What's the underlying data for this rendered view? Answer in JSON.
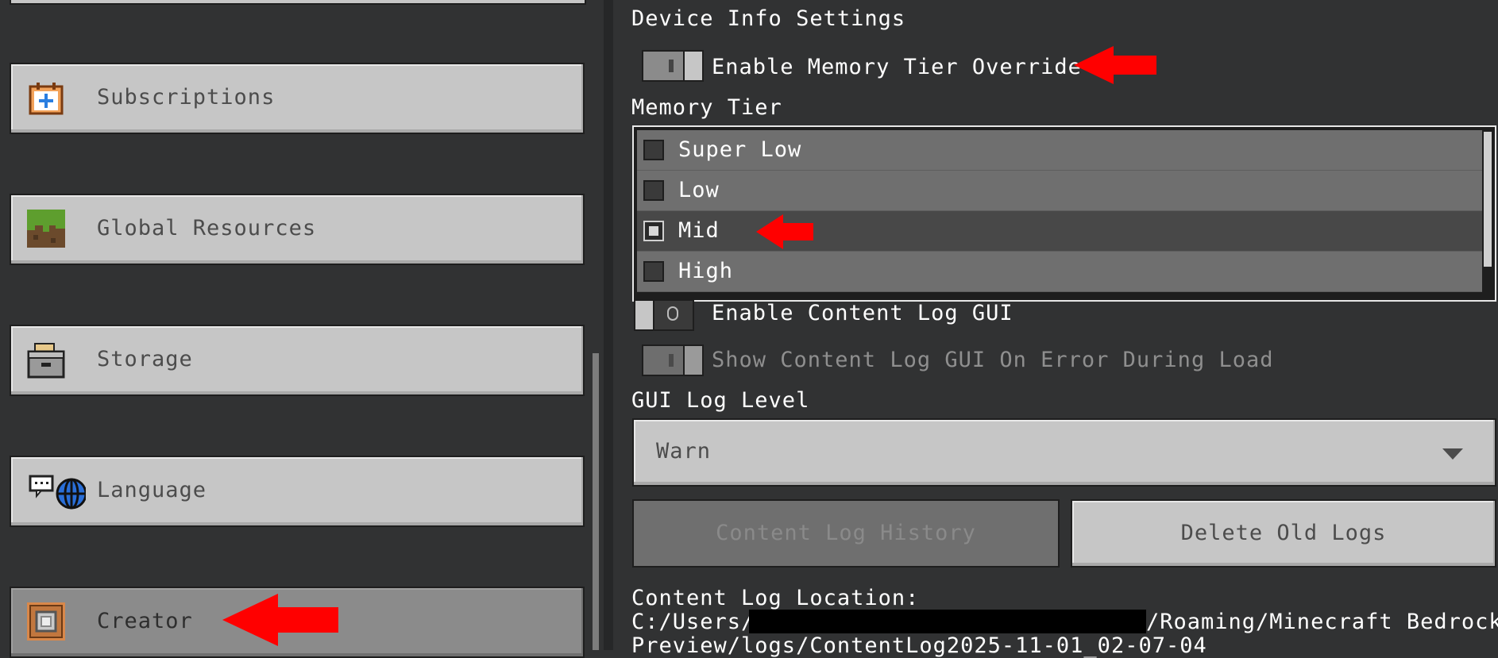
{
  "sidebar": {
    "items": [
      {
        "label": "Subscriptions",
        "icon": "subscriptions-icon"
      },
      {
        "label": "Global Resources",
        "icon": "grass-block-icon"
      },
      {
        "label": "Storage",
        "icon": "storage-box-icon"
      },
      {
        "label": "Language",
        "icon": "language-globe-icon"
      },
      {
        "label": "Creator",
        "icon": "command-block-icon",
        "selected": true
      }
    ]
  },
  "device_info": {
    "heading": "Device Info Settings",
    "memory_override_label": "Enable Memory Tier Override",
    "memory_override_on": true,
    "memory_tier_label": "Memory Tier",
    "memory_tier_options": [
      "Super Low",
      "Low",
      "Mid",
      "High"
    ],
    "memory_tier_selected": "Mid"
  },
  "content_log": {
    "gui_toggle_label": "Enable Content Log GUI",
    "gui_toggle_on": false,
    "show_on_error_label": "Show Content Log GUI On Error During Load",
    "gui_log_level_label": "GUI Log Level",
    "gui_log_level_value": "Warn",
    "history_button": "Content Log History",
    "delete_button": "Delete Old Logs",
    "location_label": "Content Log Location:",
    "path_line1_start": "C:/Users/",
    "path_line1_end": "/Roaming/Minecraft Bedrock",
    "path_line2": "Preview/logs/ContentLog2025-11-01_02-07-04"
  },
  "colors": {
    "background": "#313233",
    "button": "#c6c6c6",
    "annotation_arrow": "#ff0000"
  }
}
